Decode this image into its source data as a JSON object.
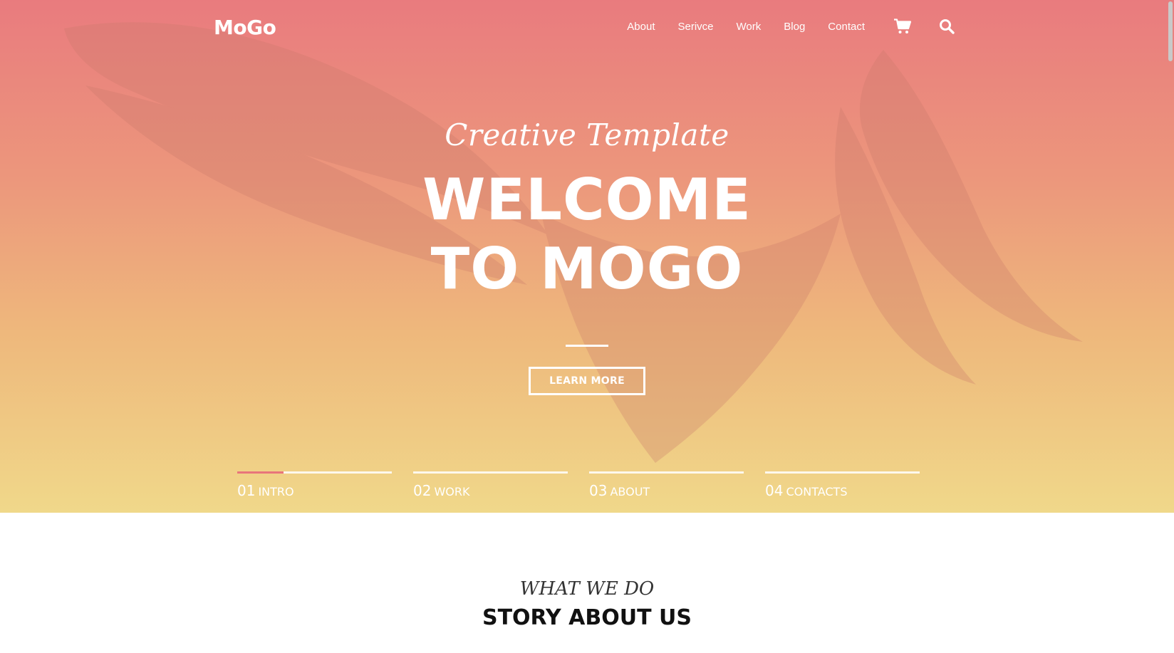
{
  "header": {
    "logo": "MoGo",
    "nav": [
      "About",
      "Serivce",
      "Work",
      "Blog",
      "Contact"
    ],
    "icons": [
      "cart-icon",
      "search-icon"
    ]
  },
  "hero": {
    "tagline": "Creative Template",
    "title_line1": "WELCOME",
    "title_line2": "TO MOGO",
    "button_label": "LEARN MORE"
  },
  "slides": [
    {
      "num": "01",
      "label": "INTRO",
      "progress": 0.3
    },
    {
      "num": "02",
      "label": "WORK",
      "progress": 0
    },
    {
      "num": "03",
      "label": "ABOUT",
      "progress": 0
    },
    {
      "num": "04",
      "label": "CONTACTS",
      "progress": 0
    }
  ],
  "about": {
    "subtitle": "WHAT WE DO",
    "title": "STORY ABOUT US"
  },
  "colors": {
    "gradient_top": "#e97b7e",
    "gradient_bottom": "#f0d88a",
    "accent": "#e8757a"
  }
}
